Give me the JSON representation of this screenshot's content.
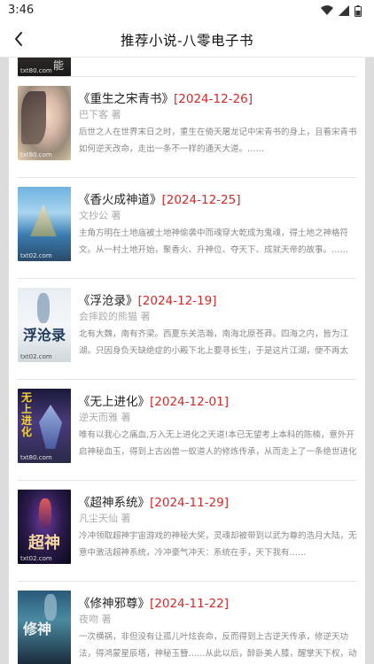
{
  "status": {
    "time": "3:46"
  },
  "header": {
    "title": "推荐小说-八零电子书"
  },
  "books": [
    {
      "title": "",
      "date": "",
      "author": "",
      "desc": "",
      "cover_text": "txt80.com"
    },
    {
      "title": "《重生之宋青书》",
      "date": "[2024-12-26]",
      "author": "巴下客 著",
      "desc": "后世之人在世界末日之时，重生在倚天屠龙记中宋青书的身上，且看宋青书如何逆天改命，走出一条不一样的通天大道。……",
      "cover_text": "txt80.com"
    },
    {
      "title": "《香火成神道》",
      "date": "[2024-12-25]",
      "author": "文抄公 著",
      "desc": "主角方明在土地庙被土地神偷袭中而魂穿大乾成为鬼魂，得土地之神格符文。从一村土地开始，聚香火、升神位、夺天下、成就天帝的故事。……",
      "cover_text": "txt02.com"
    },
    {
      "title": "《浮沧录》",
      "date": "[2024-12-19]",
      "author": "会摔跤的熊猫 著",
      "desc": "北有大魏，南有齐梁。西夏东关浩瀚，南海北原苍莽。四海之内，皆为江湖。只因身负天缺绝症的小殿下北上要寻长生，于是这片江湖，便不再太",
      "cover_text": "txt02.com"
    },
    {
      "title": "《无上进化》",
      "date": "[2024-12-01]",
      "author": "逆天而雅 著",
      "desc": "唯有以我心之痛血,方入无上进化之天道!本已无望考上本科的陈楠，意外开启神秘血玉，得到上古凶兽一蚁道人的修炼传承，从而走上了一条绝世进化的",
      "cover_text": "txt80.com"
    },
    {
      "title": "《超神系统》",
      "date": "[2024-11-29]",
      "author": "凡尘天仙 著",
      "desc": "冷冲领取超神宇宙游戏的神秘大奖，灵魂却被带到以武为尊的浩月大陆，无意中激活超神系统，冷冲豪气冲天：系统在手，天下我有……",
      "cover_text": "txt02.com"
    },
    {
      "title": "《修神邪尊》",
      "date": "[2024-11-22]",
      "author": "夜吻 著",
      "desc": "一次横祸，非但没有让孤儿叶炫丧命，反而得到上古逆天传承，修逆天功法，得鸿蒙星辰塔，神秘玉簪……从此以后，醉卧美人膝，醒掌天下权，动念",
      "cover_text": ""
    }
  ]
}
